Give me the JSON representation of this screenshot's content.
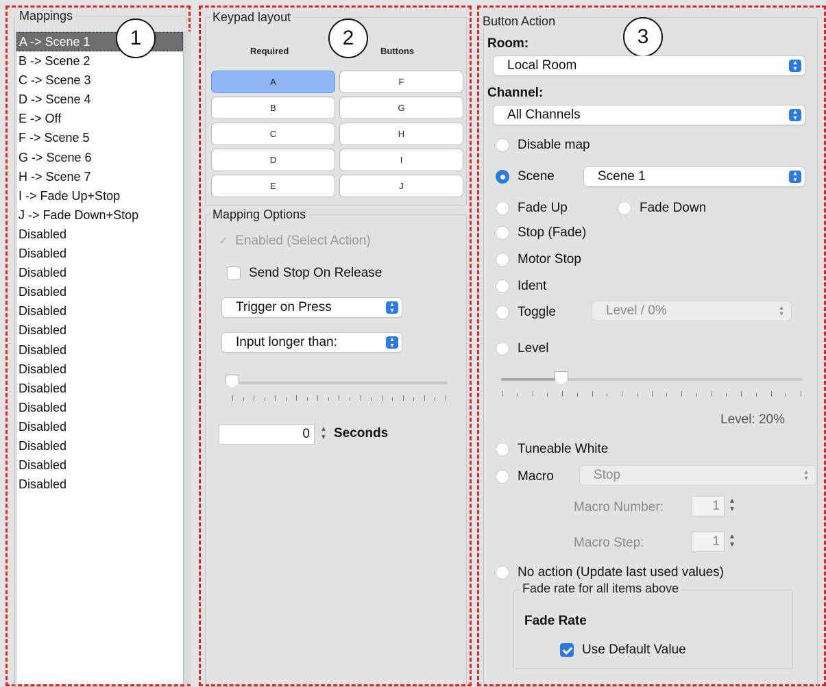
{
  "callouts": [
    "1",
    "2",
    "3"
  ],
  "mappings": {
    "title": "Mappings",
    "items": [
      "A -> Scene 1",
      "B -> Scene 2",
      "C -> Scene 3",
      "D -> Scene 4",
      "E -> Off",
      "F -> Scene 5",
      "G -> Scene 6",
      "H -> Scene 7",
      "I -> Fade Up+Stop",
      "J -> Fade Down+Stop",
      "Disabled",
      "Disabled",
      "Disabled",
      "Disabled",
      "Disabled",
      "Disabled",
      "Disabled",
      "Disabled",
      "Disabled",
      "Disabled",
      "Disabled",
      "Disabled",
      "Disabled",
      "Disabled"
    ],
    "selected_index": 0
  },
  "keypad": {
    "title": "Keypad layout",
    "header_required": "Required",
    "header_buttons": "Buttons",
    "left": [
      "A",
      "B",
      "C",
      "D",
      "E"
    ],
    "right": [
      "F",
      "G",
      "H",
      "I",
      "J"
    ],
    "active": "A"
  },
  "mapping_options": {
    "title": "Mapping Options",
    "enabled_label": "Enabled (Select Action)",
    "enabled_checked": true,
    "send_stop_label": "Send Stop On Release",
    "send_stop_checked": false,
    "trigger_select": "Trigger on Press",
    "input_select": "Input longer than:",
    "seconds_value": "0",
    "seconds_label": "Seconds"
  },
  "button_action": {
    "title": "Button Action",
    "room_label": "Room:",
    "room_value": "Local Room",
    "channel_label": "Channel:",
    "channel_value": "All Channels",
    "disable_map": "Disable map",
    "scene": "Scene",
    "scene_value": "Scene 1",
    "fade_up": "Fade Up",
    "fade_down": "Fade Down",
    "stop_fade": "Stop (Fade)",
    "motor_stop": "Motor Stop",
    "ident": "Ident",
    "toggle": "Toggle",
    "toggle_value": "Level / 0%",
    "level": "Level",
    "level_readout": "Level: 20%",
    "level_fraction": 0.2,
    "tuneable_white": "Tuneable White",
    "macro": "Macro",
    "macro_value": "Stop",
    "macro_number_label": "Macro Number:",
    "macro_number": "1",
    "macro_step_label": "Macro Step:",
    "macro_step": "1",
    "no_action": "No action (Update last used values)",
    "fade_group_title": "Fade rate for all items above",
    "fade_rate_label": "Fade Rate",
    "use_default_label": "Use Default Value",
    "use_default_checked": true
  },
  "colors": {
    "accent": "#2a7ae2",
    "dashed_border": "#e0262a",
    "keypad_active": "#8fb5f5"
  }
}
